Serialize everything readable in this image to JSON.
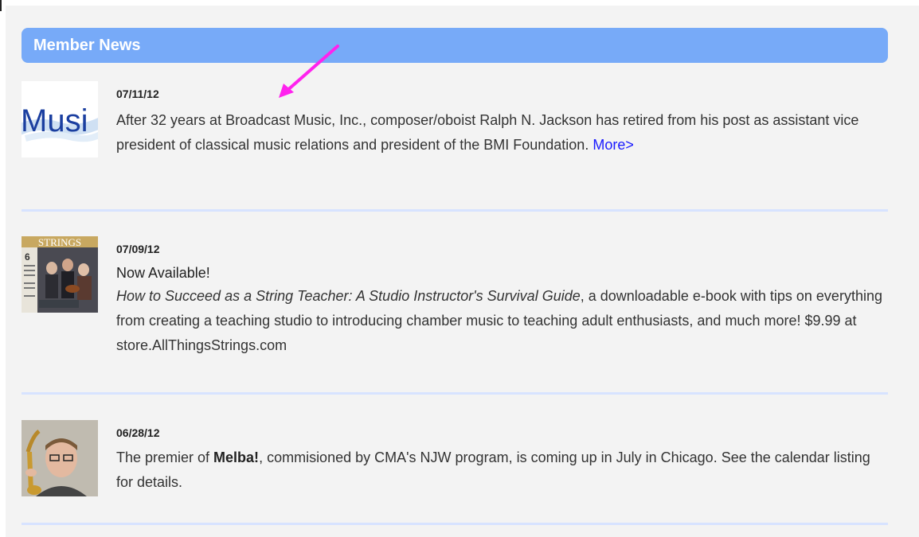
{
  "section": {
    "title": "Member News"
  },
  "news_items": [
    {
      "date": "07/11/12",
      "thumbnail": {
        "text": "Musi"
      },
      "body": "After 32 years at Broadcast Music, Inc., composer/oboist Ralph N. Jackson has retired from his post as assistant vice president of classical music relations and president of the BMI Foundation. ",
      "more_link": "More>"
    },
    {
      "date": "07/09/12",
      "thumbnail": {
        "masthead": "STRINGS",
        "issue": "6"
      },
      "headline": "Now Available!",
      "body_italic": "How to Succeed as a String Teacher: A Studio Instructor's Survival Guide",
      "body_rest": ", a downloadable e-book with tips on everything from creating a teaching studio to introducing chamber music to teaching adult enthusiasts, and much more! $9.99 at store.AllThingsStrings.com"
    },
    {
      "date": "06/28/12",
      "body_prefix": "The premier of ",
      "body_bold": "Melba!",
      "body_suffix": ", commisioned by CMA's NJW program, is coming up in July in Chicago.  See the calendar listing for details."
    }
  ],
  "colors": {
    "header_bar": "#77aaf8",
    "panel_bg": "#f3f3f3",
    "divider": "#d7e3ff",
    "link": "#1a1aff",
    "annotation_arrow": "#ff22ee"
  }
}
